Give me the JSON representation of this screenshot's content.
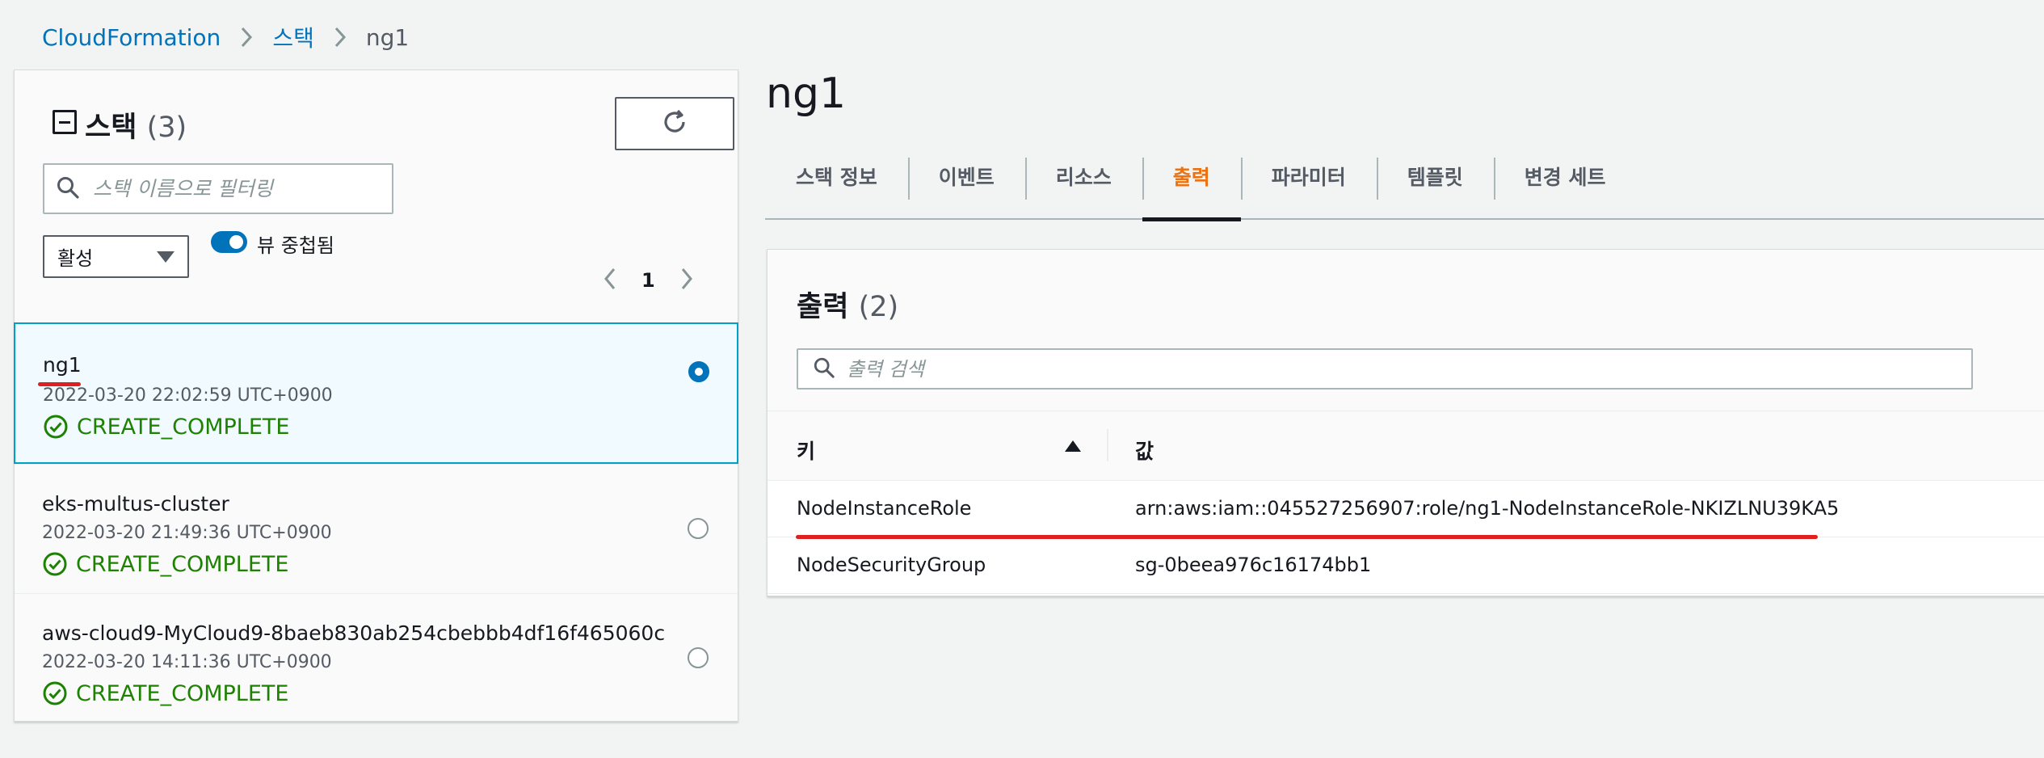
{
  "breadcrumb": {
    "root": "CloudFormation",
    "section": "스택",
    "current": "ng1"
  },
  "stacks_panel": {
    "title": "스택",
    "count": "(3)",
    "search_placeholder": "스택 이름으로 필터링",
    "filter_value": "활성",
    "nested_view_label": "뷰 중첩됨",
    "nested_view_on": true,
    "page": "1",
    "items": [
      {
        "name": "ng1",
        "time": "2022-03-20 22:02:59 UTC+0900",
        "status": "CREATE_COMPLETE",
        "selected": true
      },
      {
        "name": "eks-multus-cluster",
        "time": "2022-03-20 21:49:36 UTC+0900",
        "status": "CREATE_COMPLETE",
        "selected": false
      },
      {
        "name": "aws-cloud9-MyCloud9-8baeb830ab254cbebbb4df16f465060c",
        "time": "2022-03-20 14:11:36 UTC+0900",
        "status": "CREATE_COMPLETE",
        "selected": false
      }
    ]
  },
  "detail": {
    "title": "ng1",
    "tabs": [
      {
        "label": "스택 정보",
        "active": false
      },
      {
        "label": "이벤트",
        "active": false
      },
      {
        "label": "리소스",
        "active": false
      },
      {
        "label": "출력",
        "active": true
      },
      {
        "label": "파라미터",
        "active": false
      },
      {
        "label": "템플릿",
        "active": false
      },
      {
        "label": "변경 세트",
        "active": false
      }
    ],
    "outputs": {
      "title": "출력",
      "count": "(2)",
      "search_placeholder": "출력 검색",
      "columns": {
        "key": "키",
        "value": "값"
      },
      "rows": [
        {
          "key": "NodeInstanceRole",
          "value": "arn:aws:iam::045527256907:role/ng1-NodeInstanceRole-NKIZLNU39KA5"
        },
        {
          "key": "NodeSecurityGroup",
          "value": "sg-0beea976c16174bb1"
        }
      ]
    }
  },
  "colors": {
    "link": "#0073bb",
    "success": "#1d8102",
    "active_tab": "#ec7211",
    "annotation": "#e02020"
  }
}
